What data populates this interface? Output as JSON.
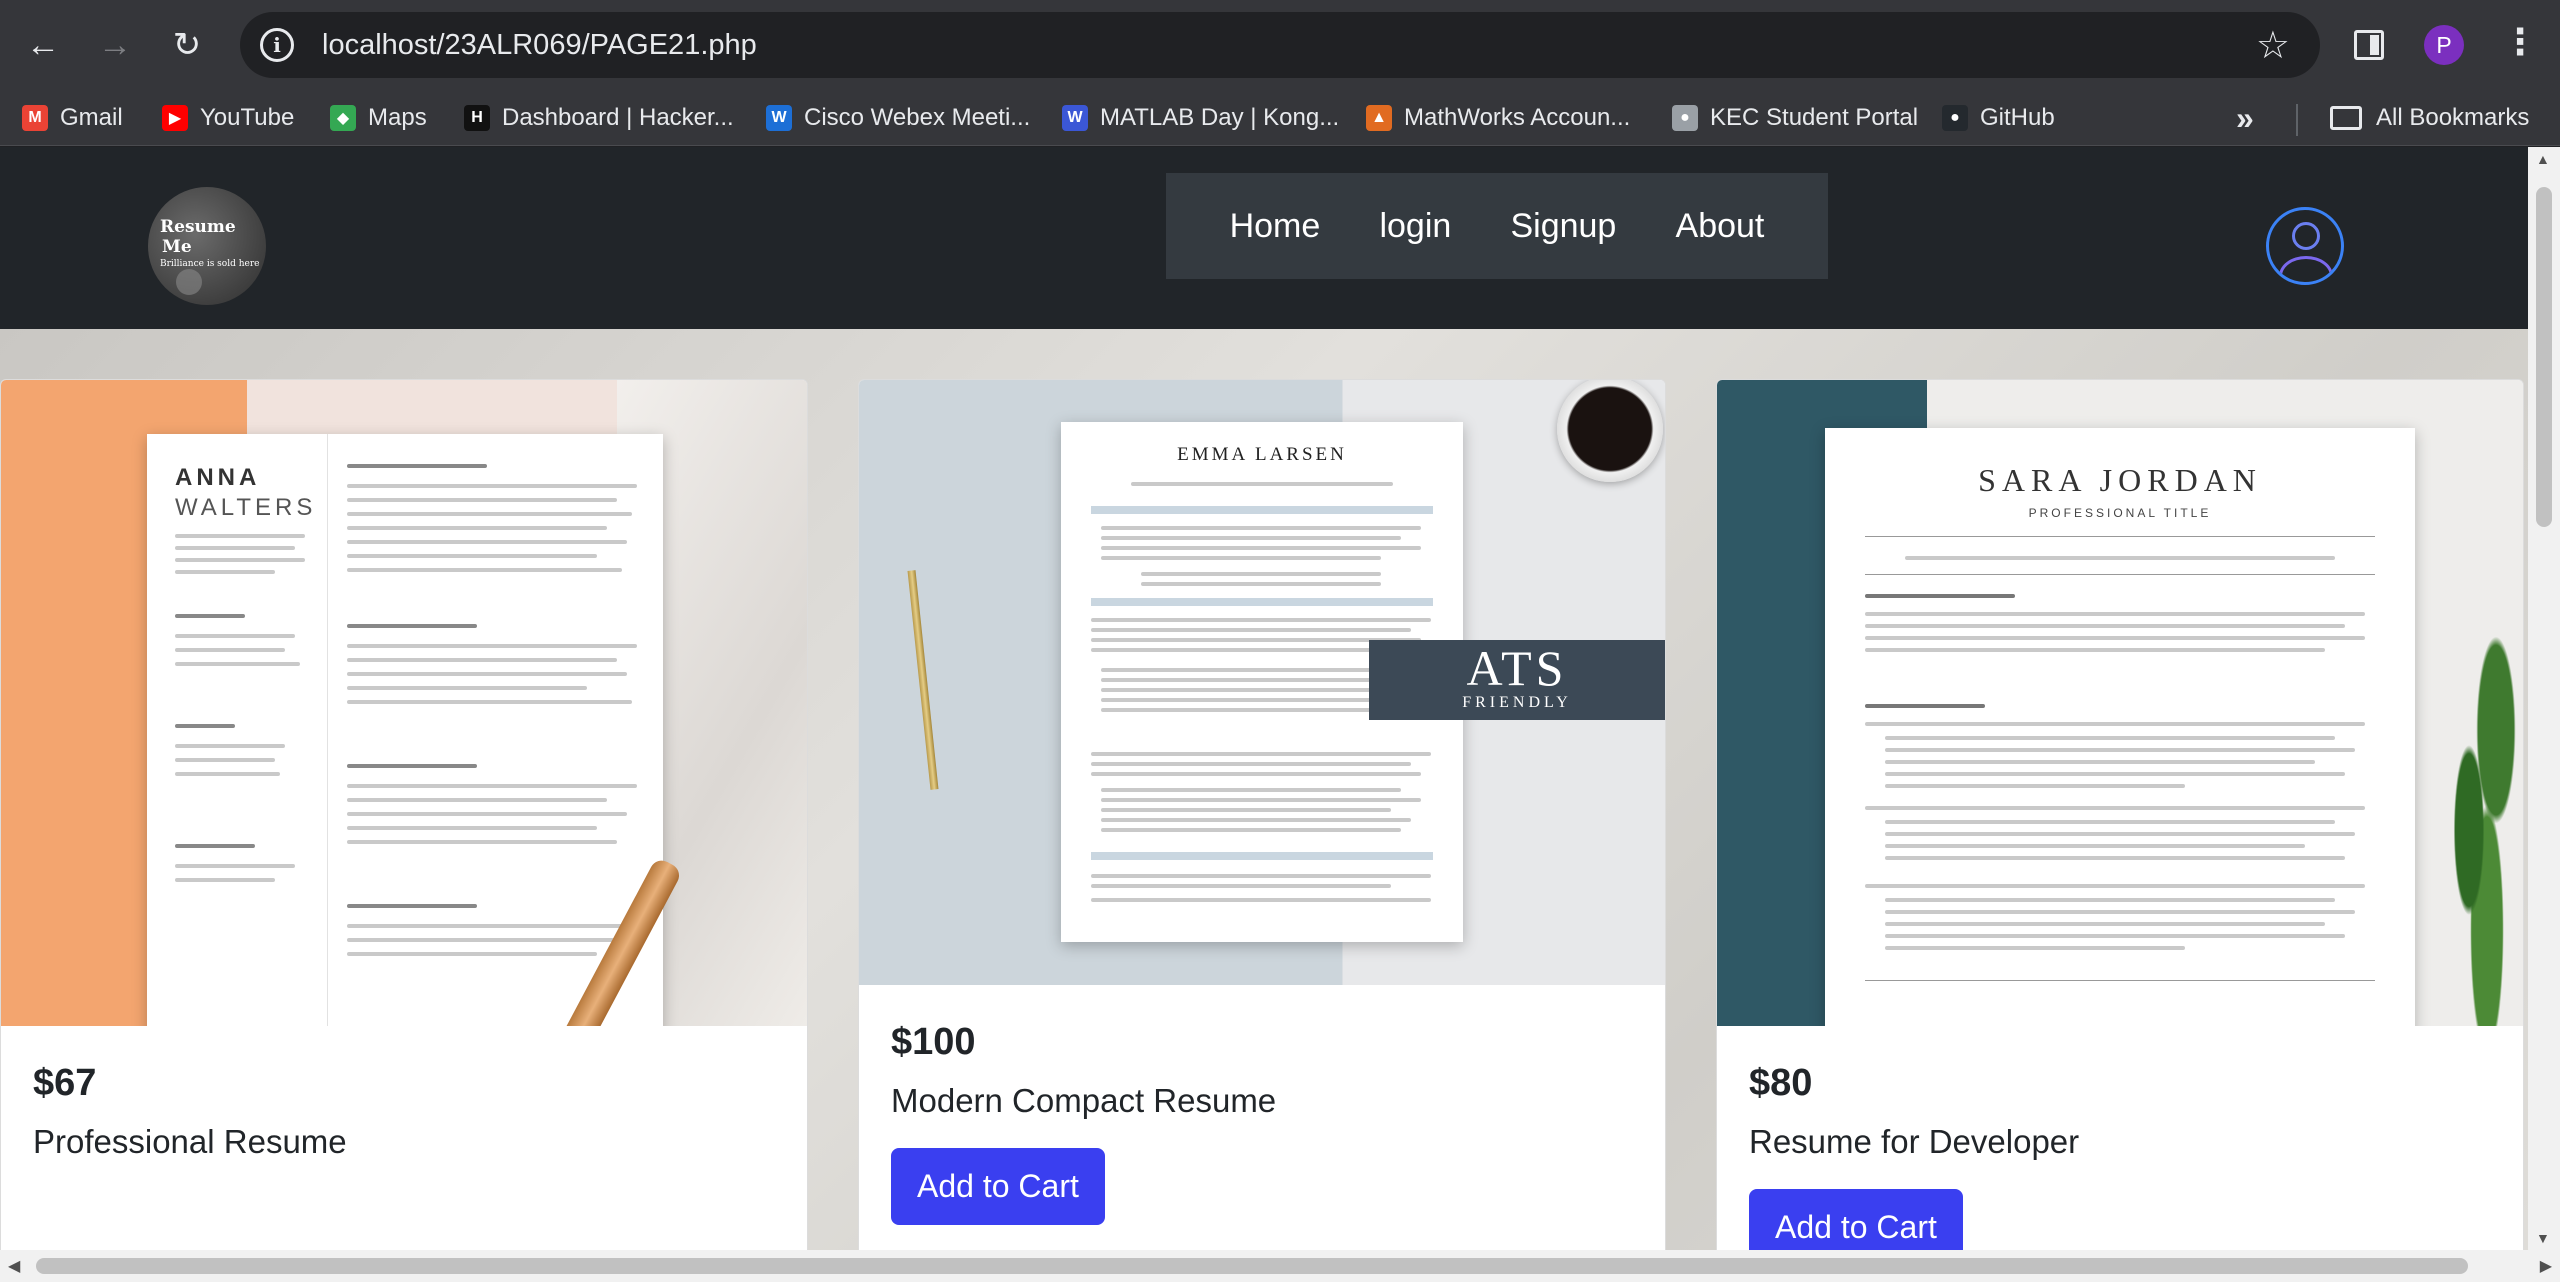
{
  "browser": {
    "url": "localhost/23ALR069/PAGE21.php",
    "profile_initial": "P",
    "bookmarks": [
      {
        "label": "Gmail",
        "icon": "gmail-icon",
        "color": "#ea4335",
        "glyph": "M"
      },
      {
        "label": "YouTube",
        "icon": "youtube-icon",
        "color": "#ff0000",
        "glyph": "▶"
      },
      {
        "label": "Maps",
        "icon": "maps-icon",
        "color": "#34a853",
        "glyph": "◆"
      },
      {
        "label": "Dashboard | Hacker...",
        "icon": "hackerrank-icon",
        "color": "#111111",
        "glyph": "H"
      },
      {
        "label": "Cisco Webex Meeti...",
        "icon": "webex-icon",
        "color": "#1d6fd6",
        "glyph": "W"
      },
      {
        "label": "MATLAB Day | Kong...",
        "icon": "kongu-icon",
        "color": "#3b57d6",
        "glyph": "W"
      },
      {
        "label": "MathWorks Accoun...",
        "icon": "mathworks-icon",
        "color": "#e16b21",
        "glyph": "▲"
      },
      {
        "label": "KEC Student Portal",
        "icon": "globe-icon",
        "color": "#9aa0a6",
        "glyph": "●"
      },
      {
        "label": "GitHub",
        "icon": "github-icon",
        "color": "#24292e",
        "glyph": "●"
      }
    ],
    "all_bookmarks": "All Bookmarks"
  },
  "site": {
    "logo": {
      "line1": "Resume",
      "line2": "Me",
      "line3": "Brilliance is sold here"
    },
    "nav": [
      "Home",
      "login",
      "Signup",
      "About"
    ]
  },
  "products": [
    {
      "price": "$67",
      "title": "Professional Resume",
      "button": "",
      "resume_name": "ANNA",
      "resume_surname": "WALTERS"
    },
    {
      "price": "$100",
      "title": "Modern Compact Resume",
      "button": "Add to Cart",
      "resume_name": "EMMA LARSEN",
      "badge": "ATS",
      "badge_sub": "FRIENDLY"
    },
    {
      "price": "$80",
      "title": "Resume for Developer",
      "button": "Add to Cart",
      "resume_name": "SARA JORDAN",
      "resume_subtitle": "PROFESSIONAL TITLE"
    }
  ]
}
